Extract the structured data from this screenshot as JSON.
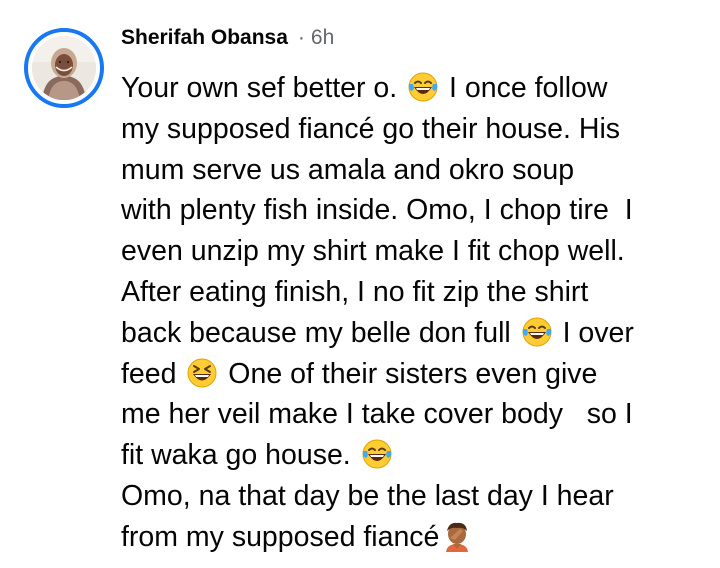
{
  "comment": {
    "author": "Sherifah Obansa",
    "separator": "·",
    "time": "6h",
    "avatar_icon": "profile-photo-hijab",
    "ring_color": "#1877f2",
    "lines": [
      {
        "parts": [
          "Your own sef better o. ",
          {
            "emoji": "tears-of-joy"
          },
          " I once follow"
        ]
      },
      {
        "parts": [
          "my supposed fiancé go their house. His"
        ]
      },
      {
        "parts": [
          "mum serve us amala and okro soup"
        ]
      },
      {
        "parts": [
          "with plenty fish inside. Omo, I chop tire  I"
        ]
      },
      {
        "parts": [
          "even unzip my shirt make I fit chop well."
        ]
      },
      {
        "parts": [
          "After eating finish, I no fit zip the shirt"
        ]
      },
      {
        "parts": [
          "back because my belle don full ",
          {
            "emoji": "tears-of-joy"
          },
          " I over"
        ]
      },
      {
        "parts": [
          "feed ",
          {
            "emoji": "grinning-squinting"
          },
          " One of their sisters even give"
        ]
      },
      {
        "parts": [
          "me her veil make I take cover body   so I"
        ]
      },
      {
        "parts": [
          "fit waka go house. ",
          {
            "emoji": "tears-of-joy"
          }
        ]
      },
      {
        "parts": [
          "Omo, na that day be the last day I hear"
        ]
      },
      {
        "parts": [
          "from my supposed fiancé",
          {
            "emoji": "facepalm"
          }
        ]
      }
    ]
  }
}
